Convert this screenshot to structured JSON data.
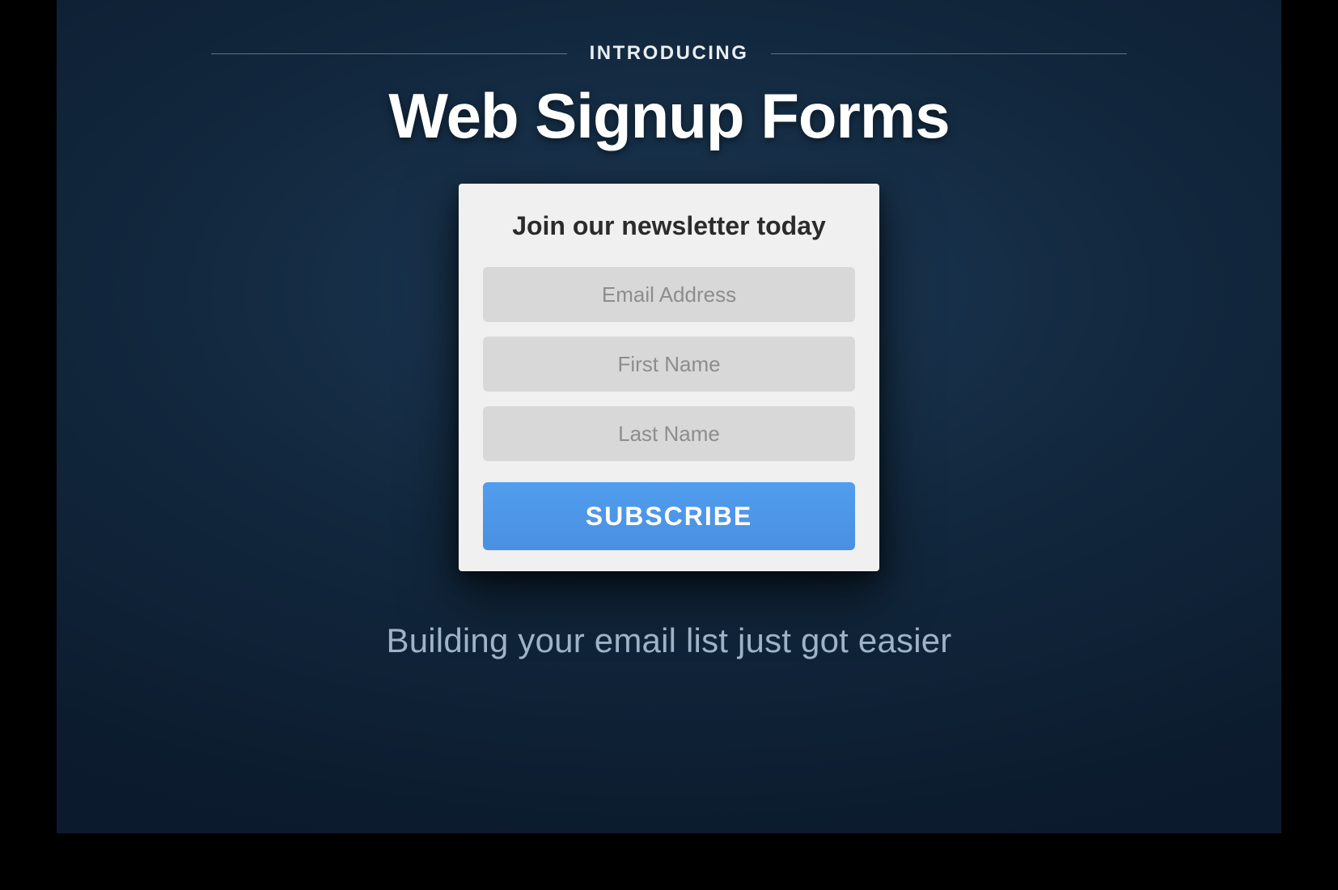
{
  "header": {
    "eyebrow": "INTRODUCING",
    "title": "Web Signup Forms"
  },
  "form": {
    "heading": "Join our newsletter today",
    "fields": {
      "email": {
        "placeholder": "Email Address",
        "value": ""
      },
      "first_name": {
        "placeholder": "First Name",
        "value": ""
      },
      "last_name": {
        "placeholder": "Last Name",
        "value": ""
      }
    },
    "submit_label": "SUBSCRIBE"
  },
  "tagline": "Building your email list just got easier",
  "colors": {
    "accent": "#4a90e2",
    "bg_dark": "#0f2238",
    "card_bg": "#f0f0f0",
    "input_bg": "#d8d8d8"
  }
}
